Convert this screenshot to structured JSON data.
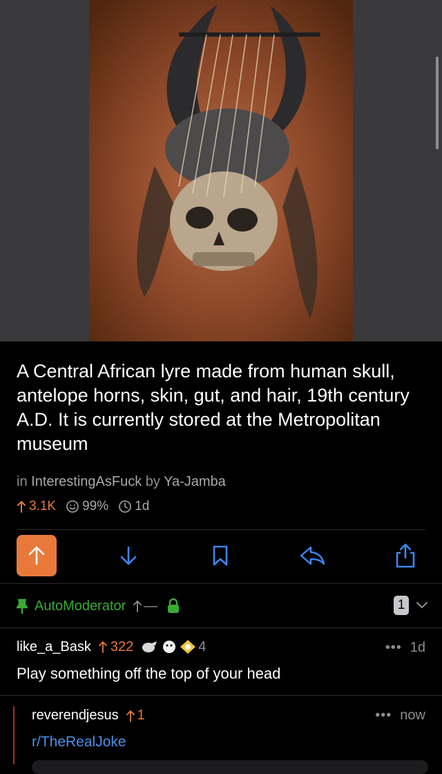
{
  "post": {
    "image_icon": "skull-lyre-photo",
    "title": "A Central African lyre made from human skull, antelope horns, skin, gut, and hair, 19th century A.D. It is currently stored at the Metropolitan museum",
    "in_label": "in",
    "subreddit": "InterestingAsFuck",
    "by_label": "by",
    "author": "Ya-Jamba",
    "score": "3.1K",
    "ratio": "99%",
    "age": "1d"
  },
  "actions": {
    "upvote_icon": "arrow-up-icon",
    "downvote_icon": "arrow-down-icon",
    "save_icon": "bookmark-icon",
    "reply_icon": "reply-icon",
    "share_icon": "share-icon"
  },
  "comments": {
    "automod": {
      "name": "AutoModerator",
      "score": "—",
      "collapsed_count": "1"
    },
    "c1": {
      "author": "like_a_Bask",
      "score": "322",
      "award_count": "4",
      "age": "1d",
      "body": "Play something off the top of your head"
    },
    "c2": {
      "author": "reverendjesus",
      "score": "1",
      "age": "now",
      "body": "r/TheRealJoke"
    }
  },
  "colors": {
    "accent": "#e8793a",
    "mod_green": "#3aaa35",
    "link_blue": "#4a8fe8",
    "secondary": "#8e8e93"
  }
}
